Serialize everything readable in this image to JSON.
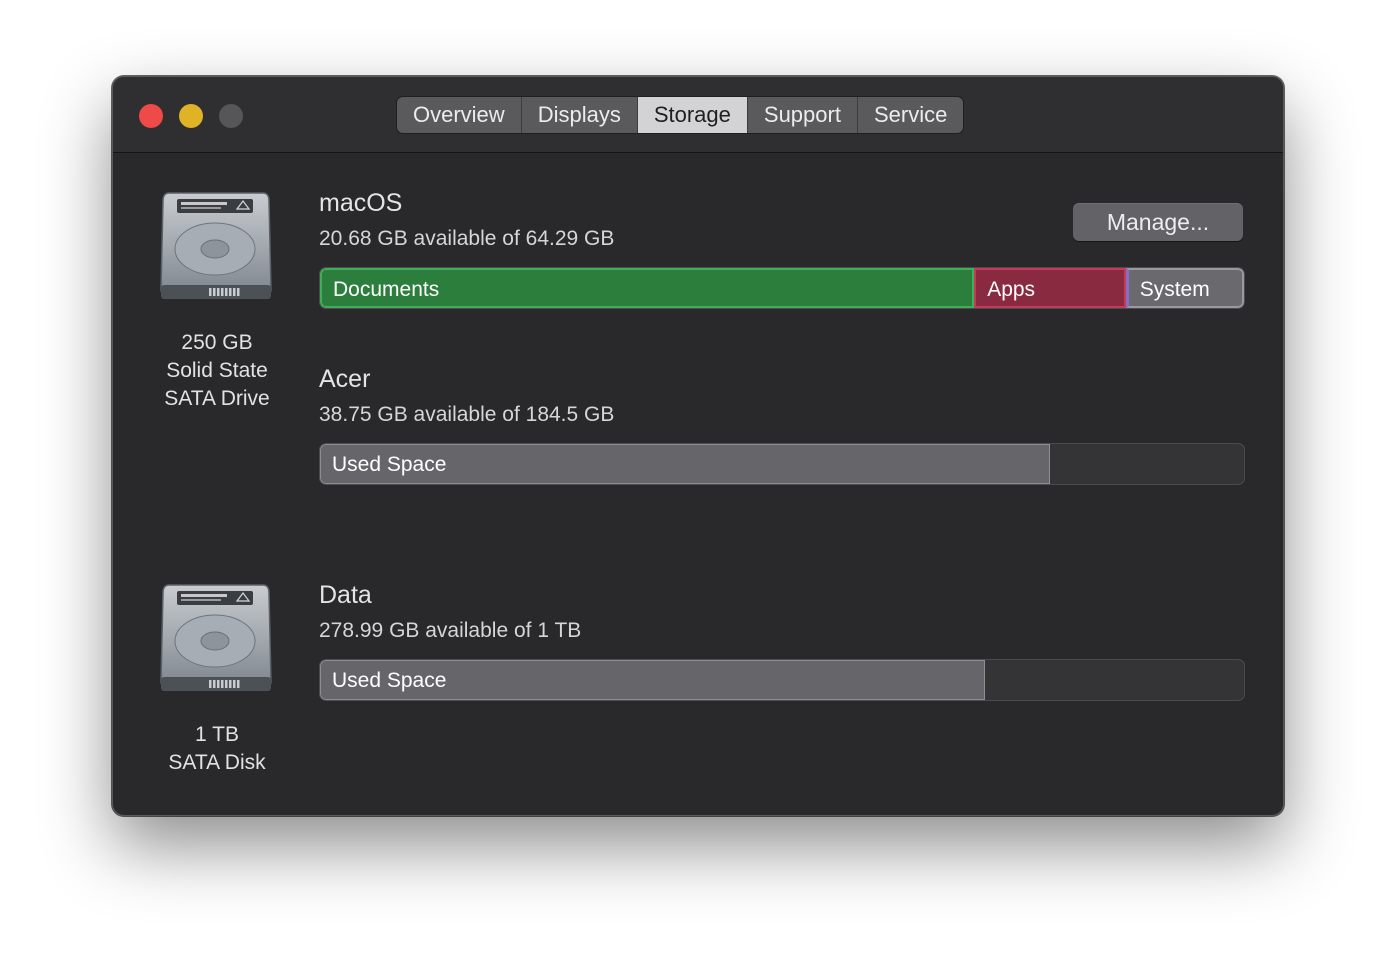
{
  "tabs": [
    {
      "label": "Overview",
      "active": false
    },
    {
      "label": "Displays",
      "active": false
    },
    {
      "label": "Storage",
      "active": true
    },
    {
      "label": "Support",
      "active": false
    },
    {
      "label": "Service",
      "active": false
    }
  ],
  "drives": [
    {
      "caption_lines": [
        "250 GB",
        "Solid State",
        "SATA Drive"
      ],
      "icon": "hard-drive-icon"
    },
    {
      "caption_lines": [
        "1 TB",
        "SATA Disk"
      ],
      "icon": "hard-drive-icon"
    }
  ],
  "manage_label": "Manage...",
  "volumes": [
    {
      "name": "macOS",
      "available": "20.68 GB available of 64.29 GB",
      "segments": [
        {
          "label": "Documents",
          "fraction": 0.708,
          "color": "#2c7e3d"
        },
        {
          "label": "Apps",
          "fraction": 0.164,
          "color": "#8a2a40"
        },
        {
          "label": "System",
          "fraction": 0.128,
          "color": "#6a696d"
        }
      ]
    },
    {
      "name": "Acer",
      "available": "38.75 GB available of 184.5 GB",
      "segments": [
        {
          "label": "Used Space",
          "fraction": 0.79,
          "color": "#666569"
        }
      ]
    },
    {
      "name": "Data",
      "available": "278.99 GB available of 1 TB",
      "segments": [
        {
          "label": "Used Space",
          "fraction": 0.72,
          "color": "#666569"
        }
      ]
    }
  ],
  "colors": {
    "window_bg": "#29282a",
    "close": "#ed4a48",
    "minimize": "#e0b327",
    "zoom_disabled": "#565558"
  }
}
